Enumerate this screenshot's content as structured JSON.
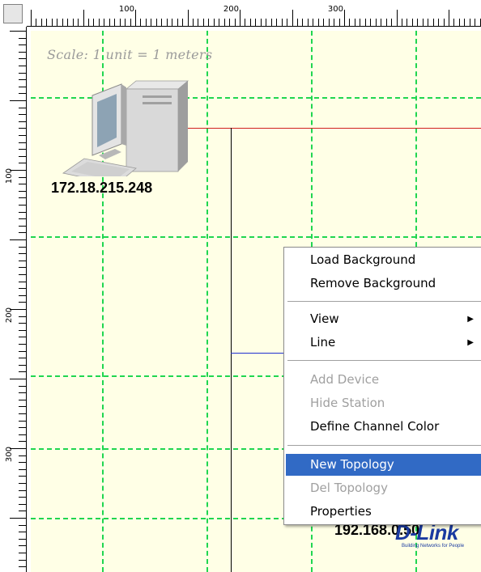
{
  "ruler": {
    "h_labels": [
      "100",
      "200",
      "300"
    ],
    "v_labels": [
      "100",
      "200",
      "300"
    ]
  },
  "canvas": {
    "scale_text": "Scale: 1 unit = 1 meters",
    "background_color": "#ffffe6",
    "grid_color": "#20d650"
  },
  "devices": [
    {
      "ip": "172.18.215.248",
      "icon": "computer-icon"
    },
    {
      "ip": "192.168.0.50",
      "icon": "dlink-logo-icon"
    }
  ],
  "logo": {
    "text": "D-Link",
    "tagline": "Building Networks for People"
  },
  "context_menu": {
    "items": [
      {
        "label": "Load Background",
        "enabled": true
      },
      {
        "label": "Remove Background",
        "enabled": true
      },
      {
        "label": "View",
        "enabled": true,
        "submenu": true
      },
      {
        "label": "Line",
        "enabled": true,
        "submenu": true
      },
      {
        "label": "Add Device",
        "enabled": false
      },
      {
        "label": "Hide Station",
        "enabled": false
      },
      {
        "label": "Define Channel Color",
        "enabled": true
      },
      {
        "label": "New Topology",
        "enabled": true,
        "highlighted": true
      },
      {
        "label": "Del Topology",
        "enabled": false
      },
      {
        "label": "Properties",
        "enabled": true
      }
    ],
    "highlight_color": "#316ac5"
  },
  "lines": {
    "red": "#d02020",
    "black": "#000000",
    "blue": "#2030d0"
  }
}
